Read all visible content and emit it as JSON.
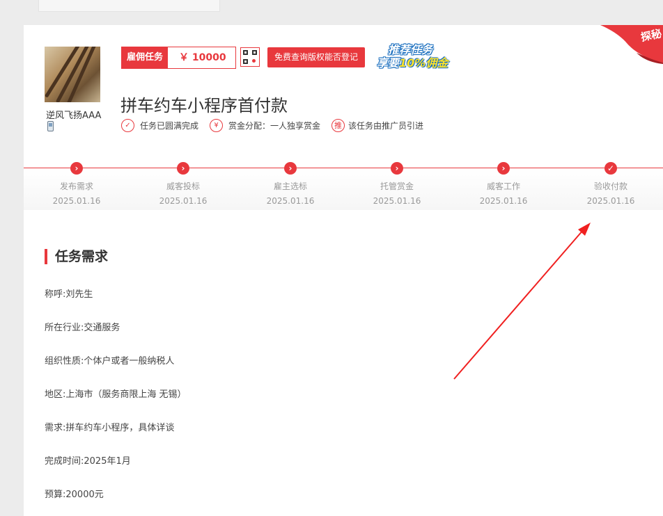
{
  "task": {
    "employer_name": "逆风飞扬AAA",
    "type_label": "雇佣任务",
    "price": "￥ 10000",
    "copyright_button": "免费查询版权能否登记",
    "promo_line1": "推荐任务",
    "promo_line2_prefix": "享要",
    "promo_line2_highlight": "10%佣金",
    "title": "拼车约车小程序首付款",
    "corner_ribbon": "探秘",
    "badges": [
      {
        "icon": "check-circle-icon",
        "icon_glyph": "✓",
        "text": "任务已圆满完成"
      },
      {
        "icon": "yen-circle-icon",
        "icon_glyph": "¥",
        "text": "赏金分配：一人独享赏金"
      },
      {
        "icon": "promote-circle-icon",
        "icon_glyph": "推",
        "text": "该任务由推广员引进"
      }
    ]
  },
  "steps": [
    {
      "label": "发布需求",
      "date": "2025.01.16",
      "icon": "chevron-right-icon",
      "glyph": "›"
    },
    {
      "label": "威客投标",
      "date": "2025.01.16",
      "icon": "chevron-right-icon",
      "glyph": "›"
    },
    {
      "label": "雇主选标",
      "date": "2025.01.16",
      "icon": "chevron-right-icon",
      "glyph": "›"
    },
    {
      "label": "托管赏金",
      "date": "2025.01.16",
      "icon": "chevron-right-icon",
      "glyph": "›"
    },
    {
      "label": "威客工作",
      "date": "2025.01.16",
      "icon": "chevron-right-icon",
      "glyph": "›"
    },
    {
      "label": "验收付款",
      "date": "2025.01.16",
      "icon": "check-icon",
      "glyph": "✓"
    }
  ],
  "requirements": {
    "section_title": "任务需求",
    "lines": [
      "称呼:刘先生",
      "所在行业:交通服务",
      "组织性质:个体户或者一般纳税人",
      "地区:上海市（服务商限上海 无锡）",
      "需求:拼车约车小程序，具体详谈",
      "完成时间:2025年1月",
      "预算:20000元"
    ]
  },
  "colors": {
    "accent": "#e8383d",
    "muted": "#999999",
    "promo_blue": "#1b6fbf",
    "promo_yellow": "#ffe32a"
  }
}
